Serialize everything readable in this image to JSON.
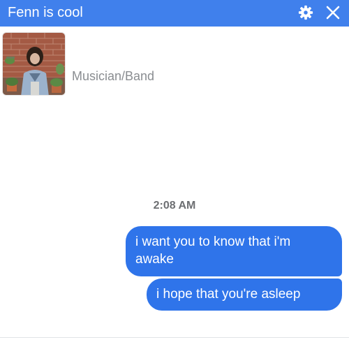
{
  "header": {
    "title": "Fenn is cool",
    "background_color": "#4080ec",
    "gear_icon": "gear-icon",
    "close_icon": "close-icon"
  },
  "profile": {
    "category": "Musician/Band",
    "avatar": "avatar-photo"
  },
  "conversation": {
    "timestamp": "2:08 AM",
    "bubble_color": "#2f74ea",
    "messages": [
      {
        "text": "i want you to know that i'm awake"
      },
      {
        "text": "i hope that you're asleep"
      }
    ]
  }
}
